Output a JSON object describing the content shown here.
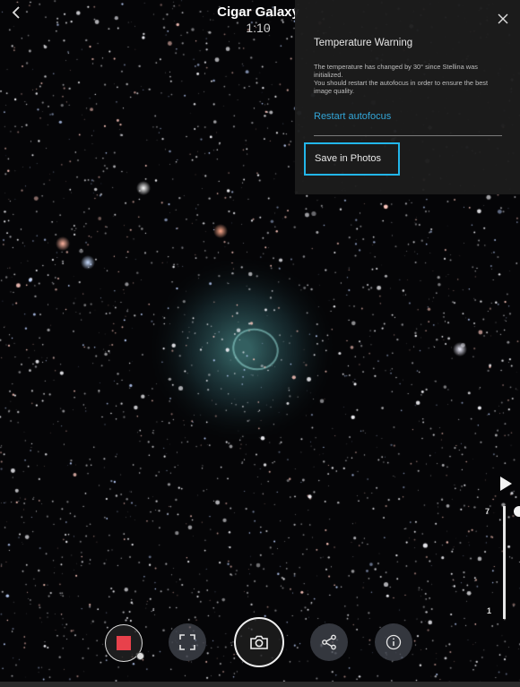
{
  "header": {
    "back_icon": "chevron-left-icon",
    "title": "Cigar Galaxy",
    "subtitle": "1:10"
  },
  "warning_panel": {
    "close_icon": "close-icon",
    "title": "Temperature Warning",
    "body_line1": "The temperature has changed by 30° since Stellina was initialized.",
    "body_line2": "You should restart the autofocus in order to ensure the best image quality.",
    "restart_label": "Restart autofocus",
    "save_label": "Save in Photos",
    "link_color": "#33a6d8",
    "highlight_color": "#22b6ea"
  },
  "toolbar": {
    "record_icon": "record-stop-icon",
    "frame_icon": "frame-icon",
    "shutter_icon": "camera-icon",
    "share_icon": "share-icon",
    "info_icon": "info-icon",
    "record_color": "#e8414b"
  },
  "slider": {
    "play_icon": "play-icon",
    "top_label": "7",
    "bottom_label": "1",
    "level": 1.0
  }
}
